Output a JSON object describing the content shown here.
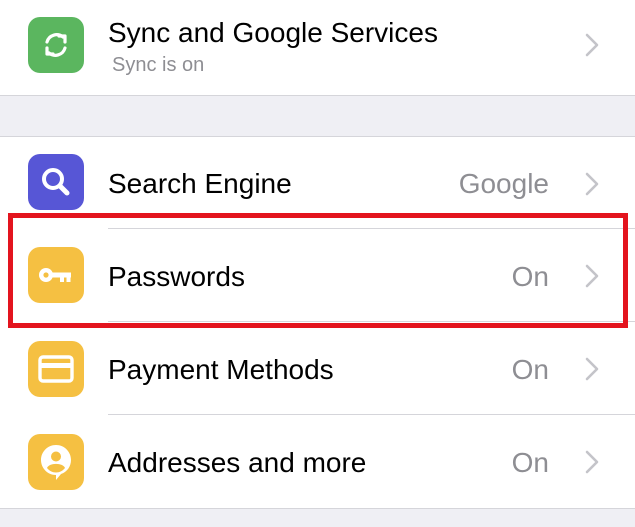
{
  "sync": {
    "title": "Sync and Google Services",
    "subtitle": "Sync is on",
    "icon": "sync-icon",
    "icon_color": "#5bb65f"
  },
  "settings": [
    {
      "label": "Search Engine",
      "value": "Google",
      "icon": "search-icon",
      "icon_color": "#5756d6"
    },
    {
      "label": "Passwords",
      "value": "On",
      "icon": "key-icon",
      "icon_color": "#f5c042",
      "highlighted": true
    },
    {
      "label": "Payment Methods",
      "value": "On",
      "icon": "credit-card-icon",
      "icon_color": "#f5c042"
    },
    {
      "label": "Addresses and more",
      "value": "On",
      "icon": "address-pin-icon",
      "icon_color": "#f5c042"
    }
  ],
  "highlight_color": "#e3141e"
}
